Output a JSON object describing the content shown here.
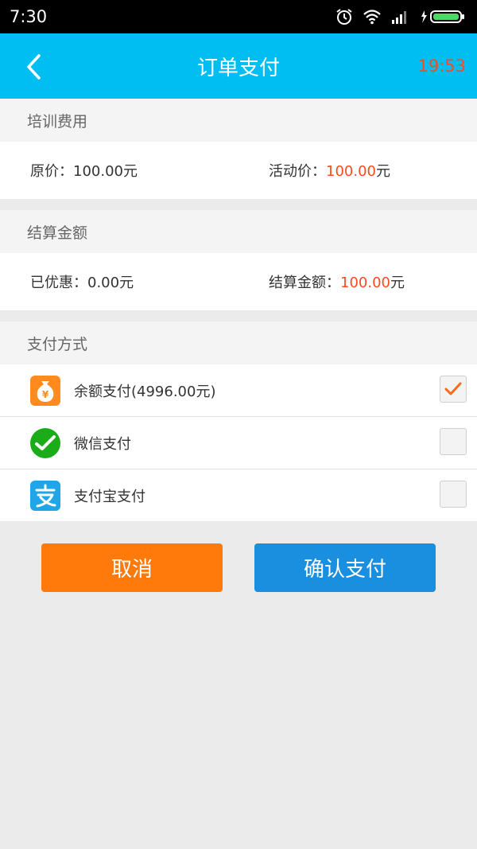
{
  "status_bar": {
    "time": "7:30"
  },
  "header": {
    "title": "订单支付",
    "countdown": "19:53"
  },
  "training_fee": {
    "section_title": "培训费用",
    "original_label": "原价：",
    "original_value": "100.00元",
    "promo_label": "活动价：",
    "promo_amount": "100.00",
    "promo_unit": "元"
  },
  "settlement": {
    "section_title": "结算金额",
    "discount_label": "已优惠：",
    "discount_value": "0.00元",
    "total_label": "结算金额：",
    "total_amount": "100.00",
    "total_unit": "元"
  },
  "payment": {
    "section_title": "支付方式",
    "methods": [
      {
        "label": "余额支付(4996.00元)",
        "icon": "wallet-icon",
        "checked": true
      },
      {
        "label": "微信支付",
        "icon": "wechat-icon",
        "checked": false
      },
      {
        "label": "支付宝支付",
        "icon": "alipay-icon",
        "checked": false
      }
    ]
  },
  "actions": {
    "cancel": "取消",
    "confirm": "确认支付"
  },
  "colors": {
    "header_bg": "#00bdf2",
    "accent_red": "#ff4a1f",
    "cancel_orange": "#ff7a0a",
    "confirm_blue": "#1a8fe0",
    "wechat_green": "#1aad19",
    "alipay_blue": "#20a6e8"
  }
}
